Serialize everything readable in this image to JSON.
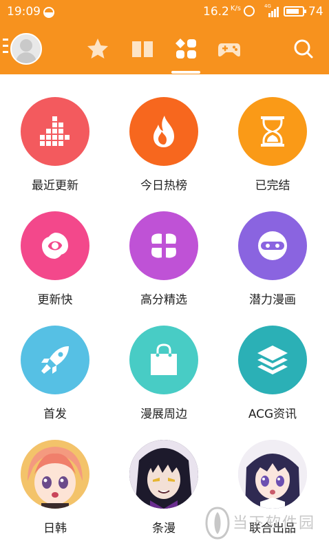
{
  "status_bar": {
    "time": "19:09",
    "network_speed": "16.2",
    "speed_unit": "K/s",
    "signal_type": "4G",
    "battery": "74"
  },
  "nav": {
    "tabs": [
      {
        "name": "favorites",
        "icon": "star-icon"
      },
      {
        "name": "bookshelf",
        "icon": "book-icon"
      },
      {
        "name": "discover",
        "icon": "grid-icon",
        "active": true
      },
      {
        "name": "games",
        "icon": "gamepad-icon"
      }
    ],
    "search_icon": "search-icon"
  },
  "categories": [
    {
      "label": "最近更新",
      "color": "#f35a5e",
      "icon": "blocks-icon"
    },
    {
      "label": "今日热榜",
      "color": "#f7671e",
      "icon": "flame-icon"
    },
    {
      "label": "已完结",
      "color": "#fa9a17",
      "icon": "hourglass-icon"
    },
    {
      "label": "更新快",
      "color": "#f3488b",
      "icon": "swirl-icon"
    },
    {
      "label": "高分精选",
      "color": "#bf52d6",
      "icon": "flower-icon"
    },
    {
      "label": "潜力漫画",
      "color": "#8a64e0",
      "icon": "ninja-icon"
    },
    {
      "label": "首发",
      "color": "#56c0e4",
      "icon": "rocket-icon"
    },
    {
      "label": "漫展周边",
      "color": "#48ccc5",
      "icon": "shopping-bag-icon"
    },
    {
      "label": "ACG资讯",
      "color": "#2bb0b6",
      "icon": "layers-icon"
    },
    {
      "label": "日韩",
      "color": "#fbe7ea",
      "icon": "anime-portrait"
    },
    {
      "label": "条漫",
      "color": "#2a2240",
      "icon": "anime-portrait"
    },
    {
      "label": "联合出品",
      "color": "#e9e0f2",
      "icon": "anime-portrait"
    }
  ],
  "watermark": {
    "text": "当下软件园"
  },
  "colors": {
    "accent": "#f7921e"
  }
}
